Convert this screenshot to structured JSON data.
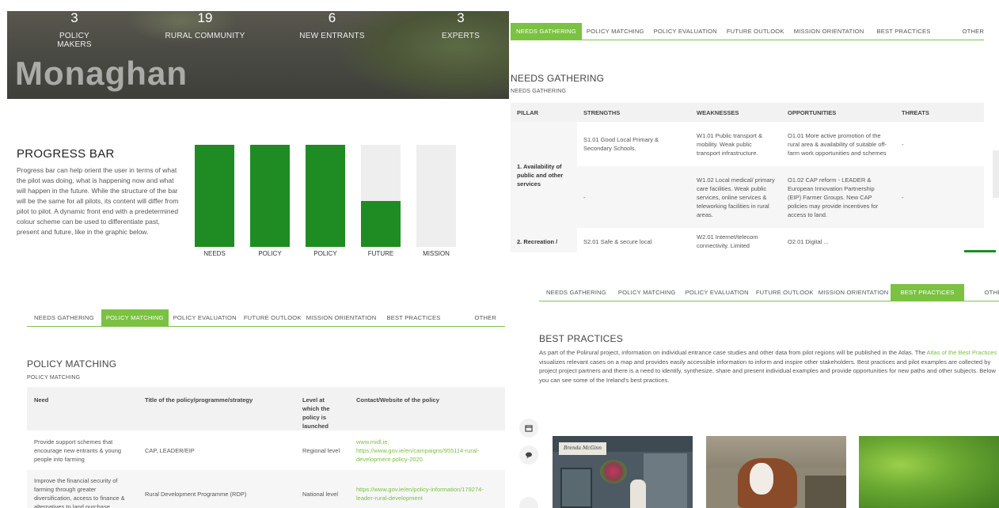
{
  "hero": {
    "stats": [
      {
        "num": "3",
        "label": "POLICY MAKERS"
      },
      {
        "num": "19",
        "label": "RURAL COMMUNITY"
      },
      {
        "num": "6",
        "label": "NEW ENTRANTS"
      },
      {
        "num": "3",
        "label": "EXPERTS"
      }
    ],
    "title": "Monaghan"
  },
  "progress": {
    "title": "PROGRESS BAR",
    "text": "Progress bar can help orient the user in terms of what the pilot was doing, what is happening now and what will happen in the future. While the structure of the bar will be the same for all pilots, its content will differ from pilot to pilot. A dynamic front end with a predetermined colour scheme can be used to differentiate past, present and future, like in the graphic below.",
    "bars": [
      {
        "label": "NEEDS",
        "fill": 1.0
      },
      {
        "label": "POLICY",
        "fill": 1.0
      },
      {
        "label": "POLICY",
        "fill": 1.0
      },
      {
        "label": "FUTURE",
        "fill": 0.45
      },
      {
        "label": "MISSION",
        "fill": 0.0
      }
    ],
    "colors": {
      "done": "#1e8c22",
      "todo": "#eeeeee"
    }
  },
  "tabs": [
    "NEEDS GATHERING",
    "POLICY MATCHING",
    "POLICY EVALUATION",
    "FUTURE OUTLOOK",
    "MISSION ORIENTATION",
    "BEST PRACTICES",
    "OTHER"
  ],
  "needs": {
    "title": "NEEDS GATHERING",
    "subtitle": "NEEDS GATHERING",
    "headers": [
      "PILLAR",
      "STRENGTHS",
      "WEAKNESSES",
      "OPPORTUNITIES",
      "THREATS"
    ],
    "pillar1": "1. Availability of public and other services",
    "row1": {
      "strength": "S1.01 Good Local Primary & Secondary Schools.",
      "weakness": "W1.01 Public transport & mobility. Weak public transport infrastructure.",
      "opportunity": "O1.01 More active promotion of the rural area & availability of suitable off-farm work opportunities and schemes",
      "threat": "-"
    },
    "row2": {
      "strength": "-",
      "weakness": "W1.02 Local medical/ primary care facilities. Weak public services, online services & teleworking facilities in rural areas.",
      "opportunity": "O1.02 CAP reform - LEADER & European Innovation Partnership (EIP) Farmer Groups. New CAP policies may provide incentives for access to land.",
      "threat": "-"
    },
    "row3": {
      "pillar": "2. Recreation /",
      "strength": "S2.01 Safe & secure local",
      "weakness": "W2.01 Internet/telecom connectivity. Limited",
      "opportunity": "O2.01 Digital ...",
      "threat": ""
    }
  },
  "policy": {
    "title": "POLICY MATCHING",
    "subtitle": "POLICY MATCHING",
    "headers": [
      "Need",
      "Title of the policy/programme/strategy",
      "Level at which the policy is launched",
      "Contact/Website of the policy"
    ],
    "rows": [
      {
        "need": "Provide support schemes that encourage new entrants & young people into farming",
        "title": "CAP, LEADER/EIP",
        "level": "Regional level",
        "contact": "www.midl.ie, https://www.gov.ie/en/campaigns/955114-rural-development-policy-2020"
      },
      {
        "need": "Improve the financial security of farming through greater diversification, access to finance & alternatives to land purchase.",
        "title": "Rural Development Programme (RDP)",
        "level": "National level",
        "contact": "https://www.gov.ie/en/policy-information/179274-leader-rural-development"
      }
    ]
  },
  "best": {
    "title": "BEST PRACTICES",
    "text_a": "As part of the Polirural project, information on individual entrance case studies and other data from pilot regions will be published in the Atlas. The ",
    "link": "Atlas of the Best Practices",
    "text_b": " visualizes relevant cases on a map and provides easily accessible information to inform and inspire other stakeholders. Best practices and pilot examples are collected by project project partners and there is a need to identify, synthesize, share and present individual examples and provide opportunities for new paths and other subjects. Below you can see some of the Ireland's best practices.",
    "shop_sign": "Brenda McGinn",
    "icons": [
      "calendar-icon",
      "chat-icon",
      "arrow-icon"
    ]
  }
}
